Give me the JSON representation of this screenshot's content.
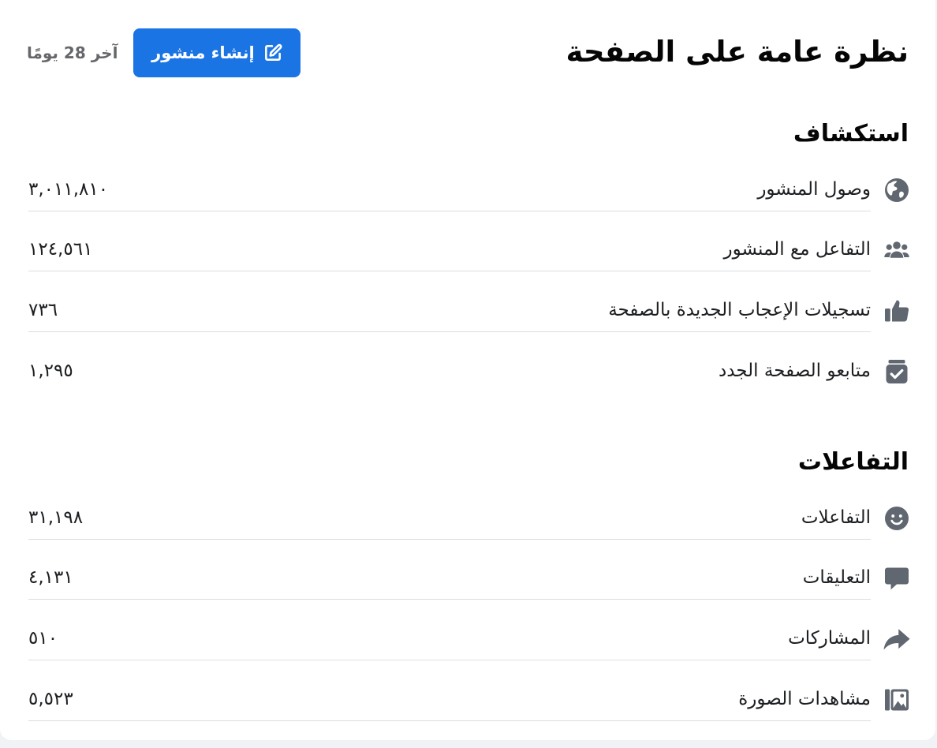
{
  "header": {
    "title": "نظرة عامة على الصفحة",
    "create_post_label": "إنشاء منشور",
    "period": "آخر 28 يومًا"
  },
  "discovery": {
    "title": "استكشاف",
    "items": [
      {
        "label": "وصول المنشور",
        "value": "٣,٠١١,٨١٠",
        "icon": "globe-icon"
      },
      {
        "label": "التفاعل مع المنشور",
        "value": "١٢٤,٥٦١",
        "icon": "people-icon"
      },
      {
        "label": "تسجيلات الإعجاب الجديدة بالصفحة",
        "value": "٧٣٦",
        "icon": "thumbs-up-icon"
      },
      {
        "label": "متابعو الصفحة الجدد",
        "value": "١,٢٩٥",
        "icon": "follow-check-icon"
      }
    ]
  },
  "interactions": {
    "title": "التفاعلات",
    "items": [
      {
        "label": "التفاعلات",
        "value": "٣١,١٩٨",
        "icon": "smiley-icon"
      },
      {
        "label": "التعليقات",
        "value": "٤,١٣١",
        "icon": "comment-icon"
      },
      {
        "label": "المشاركات",
        "value": "٥١٠",
        "icon": "share-icon"
      },
      {
        "label": "مشاهدات الصورة",
        "value": "٥,٥٢٣",
        "icon": "photo-icon"
      }
    ]
  },
  "colors": {
    "primary": "#1b74e4",
    "icon": "#606770",
    "divider": "#dadde1",
    "text": "#1c1e21",
    "secondary_text": "#65676b"
  }
}
